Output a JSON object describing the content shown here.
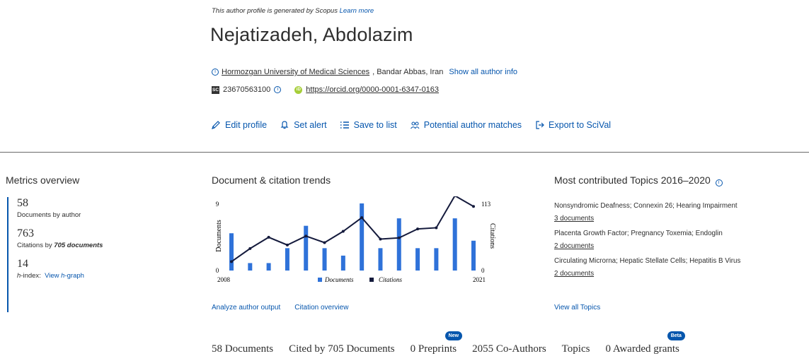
{
  "notice": {
    "text": "This author profile is generated by Scopus",
    "link": "Learn more"
  },
  "author": {
    "name": "Nejatizadeh, Abdolazim"
  },
  "affiliation": {
    "institution": "Hormozgan University of Medical Sciences",
    "location": ", Bandar Abbas, Iran",
    "show_all": "Show all author info"
  },
  "ids": {
    "scopus_id": "23670563100",
    "orcid_url": "https://orcid.org/0000-0001-6347-0163"
  },
  "actions": {
    "edit": "Edit profile",
    "alert": "Set alert",
    "save": "Save to list",
    "matches": "Potential author matches",
    "export": "Export to SciVal"
  },
  "metrics": {
    "title": "Metrics overview",
    "documents": {
      "value": "58",
      "label": "Documents by author"
    },
    "citations": {
      "value": "763",
      "label_prefix": "Citations by ",
      "label_bold": "705 documents"
    },
    "hindex": {
      "value": "14",
      "label_h": "h",
      "label_suffix": "-index:",
      "link_prefix": "View ",
      "link_h": "h",
      "link_suffix": "-graph"
    }
  },
  "trends": {
    "title": "Document & citation trends",
    "analyze_link": "Analyze author output",
    "citation_link": "Citation overview"
  },
  "chart_data": {
    "type": "bar",
    "x": [
      2008,
      2009,
      2010,
      2011,
      2012,
      2013,
      2014,
      2015,
      2016,
      2017,
      2018,
      2019,
      2020,
      2021
    ],
    "xtick_labels": [
      "2008",
      "2021"
    ],
    "ylabel_left": "Documents",
    "ylabel_right": "Citations",
    "yleft_ticks": [
      "0",
      "9"
    ],
    "yright_ticks": [
      "0",
      "113"
    ],
    "ylim_left": [
      0,
      9
    ],
    "ylim_right": [
      0,
      113
    ],
    "series": [
      {
        "name": "Documents",
        "type": "bar",
        "axis": "left",
        "values": [
          5,
          1,
          1,
          3,
          6,
          3,
          2,
          9,
          3,
          7,
          3,
          3,
          7,
          4
        ],
        "color": "#2f72d9"
      },
      {
        "name": "Citations",
        "type": "line",
        "axis": "right",
        "values": [
          15,
          37,
          56,
          43,
          58,
          47,
          66,
          89,
          53,
          55,
          70,
          72,
          126,
          108
        ],
        "color": "#141a3c"
      }
    ]
  },
  "topics": {
    "title": "Most contributed Topics 2016–2020",
    "items": [
      {
        "name": "Nonsyndromic Deafness; Connexin 26; Hearing Impairment",
        "docs": "3 documents"
      },
      {
        "name": "Placenta Growth Factor; Pregnancy Toxemia; Endoglin",
        "docs": "2 documents"
      },
      {
        "name": "Circulating Microrna; Hepatic Stellate Cells; Hepatitis B Virus",
        "docs": "2 documents"
      }
    ],
    "view_all": "View all Topics"
  },
  "tabs": [
    {
      "label": "58 Documents"
    },
    {
      "label": "Cited by 705 Documents"
    },
    {
      "label": "0 Preprints",
      "badge": "New"
    },
    {
      "label": "2055 Co-Authors"
    },
    {
      "label": "Topics"
    },
    {
      "label": "0 Awarded grants",
      "badge": "Beta"
    }
  ],
  "colors": {
    "accent": "#0656ad",
    "bar": "#2f72d9",
    "line": "#141a3c",
    "orcid": "#a6ce39"
  }
}
